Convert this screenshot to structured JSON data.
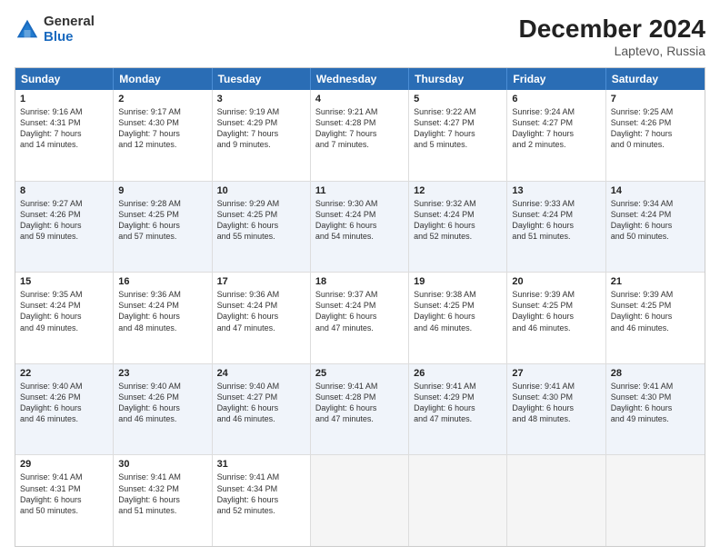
{
  "logo": {
    "general": "General",
    "blue": "Blue"
  },
  "title": "December 2024",
  "location": "Laptevo, Russia",
  "days_header": [
    "Sunday",
    "Monday",
    "Tuesday",
    "Wednesday",
    "Thursday",
    "Friday",
    "Saturday"
  ],
  "weeks": [
    [
      {
        "day": "1",
        "text": "Sunrise: 9:16 AM\nSunset: 4:31 PM\nDaylight: 7 hours\nand 14 minutes."
      },
      {
        "day": "2",
        "text": "Sunrise: 9:17 AM\nSunset: 4:30 PM\nDaylight: 7 hours\nand 12 minutes."
      },
      {
        "day": "3",
        "text": "Sunrise: 9:19 AM\nSunset: 4:29 PM\nDaylight: 7 hours\nand 9 minutes."
      },
      {
        "day": "4",
        "text": "Sunrise: 9:21 AM\nSunset: 4:28 PM\nDaylight: 7 hours\nand 7 minutes."
      },
      {
        "day": "5",
        "text": "Sunrise: 9:22 AM\nSunset: 4:27 PM\nDaylight: 7 hours\nand 5 minutes."
      },
      {
        "day": "6",
        "text": "Sunrise: 9:24 AM\nSunset: 4:27 PM\nDaylight: 7 hours\nand 2 minutes."
      },
      {
        "day": "7",
        "text": "Sunrise: 9:25 AM\nSunset: 4:26 PM\nDaylight: 7 hours\nand 0 minutes."
      }
    ],
    [
      {
        "day": "8",
        "text": "Sunrise: 9:27 AM\nSunset: 4:26 PM\nDaylight: 6 hours\nand 59 minutes."
      },
      {
        "day": "9",
        "text": "Sunrise: 9:28 AM\nSunset: 4:25 PM\nDaylight: 6 hours\nand 57 minutes."
      },
      {
        "day": "10",
        "text": "Sunrise: 9:29 AM\nSunset: 4:25 PM\nDaylight: 6 hours\nand 55 minutes."
      },
      {
        "day": "11",
        "text": "Sunrise: 9:30 AM\nSunset: 4:24 PM\nDaylight: 6 hours\nand 54 minutes."
      },
      {
        "day": "12",
        "text": "Sunrise: 9:32 AM\nSunset: 4:24 PM\nDaylight: 6 hours\nand 52 minutes."
      },
      {
        "day": "13",
        "text": "Sunrise: 9:33 AM\nSunset: 4:24 PM\nDaylight: 6 hours\nand 51 minutes."
      },
      {
        "day": "14",
        "text": "Sunrise: 9:34 AM\nSunset: 4:24 PM\nDaylight: 6 hours\nand 50 minutes."
      }
    ],
    [
      {
        "day": "15",
        "text": "Sunrise: 9:35 AM\nSunset: 4:24 PM\nDaylight: 6 hours\nand 49 minutes."
      },
      {
        "day": "16",
        "text": "Sunrise: 9:36 AM\nSunset: 4:24 PM\nDaylight: 6 hours\nand 48 minutes."
      },
      {
        "day": "17",
        "text": "Sunrise: 9:36 AM\nSunset: 4:24 PM\nDaylight: 6 hours\nand 47 minutes."
      },
      {
        "day": "18",
        "text": "Sunrise: 9:37 AM\nSunset: 4:24 PM\nDaylight: 6 hours\nand 47 minutes."
      },
      {
        "day": "19",
        "text": "Sunrise: 9:38 AM\nSunset: 4:25 PM\nDaylight: 6 hours\nand 46 minutes."
      },
      {
        "day": "20",
        "text": "Sunrise: 9:39 AM\nSunset: 4:25 PM\nDaylight: 6 hours\nand 46 minutes."
      },
      {
        "day": "21",
        "text": "Sunrise: 9:39 AM\nSunset: 4:25 PM\nDaylight: 6 hours\nand 46 minutes."
      }
    ],
    [
      {
        "day": "22",
        "text": "Sunrise: 9:40 AM\nSunset: 4:26 PM\nDaylight: 6 hours\nand 46 minutes."
      },
      {
        "day": "23",
        "text": "Sunrise: 9:40 AM\nSunset: 4:26 PM\nDaylight: 6 hours\nand 46 minutes."
      },
      {
        "day": "24",
        "text": "Sunrise: 9:40 AM\nSunset: 4:27 PM\nDaylight: 6 hours\nand 46 minutes."
      },
      {
        "day": "25",
        "text": "Sunrise: 9:41 AM\nSunset: 4:28 PM\nDaylight: 6 hours\nand 47 minutes."
      },
      {
        "day": "26",
        "text": "Sunrise: 9:41 AM\nSunset: 4:29 PM\nDaylight: 6 hours\nand 47 minutes."
      },
      {
        "day": "27",
        "text": "Sunrise: 9:41 AM\nSunset: 4:30 PM\nDaylight: 6 hours\nand 48 minutes."
      },
      {
        "day": "28",
        "text": "Sunrise: 9:41 AM\nSunset: 4:30 PM\nDaylight: 6 hours\nand 49 minutes."
      }
    ],
    [
      {
        "day": "29",
        "text": "Sunrise: 9:41 AM\nSunset: 4:31 PM\nDaylight: 6 hours\nand 50 minutes."
      },
      {
        "day": "30",
        "text": "Sunrise: 9:41 AM\nSunset: 4:32 PM\nDaylight: 6 hours\nand 51 minutes."
      },
      {
        "day": "31",
        "text": "Sunrise: 9:41 AM\nSunset: 4:34 PM\nDaylight: 6 hours\nand 52 minutes."
      },
      {
        "day": "",
        "text": ""
      },
      {
        "day": "",
        "text": ""
      },
      {
        "day": "",
        "text": ""
      },
      {
        "day": "",
        "text": ""
      }
    ]
  ]
}
